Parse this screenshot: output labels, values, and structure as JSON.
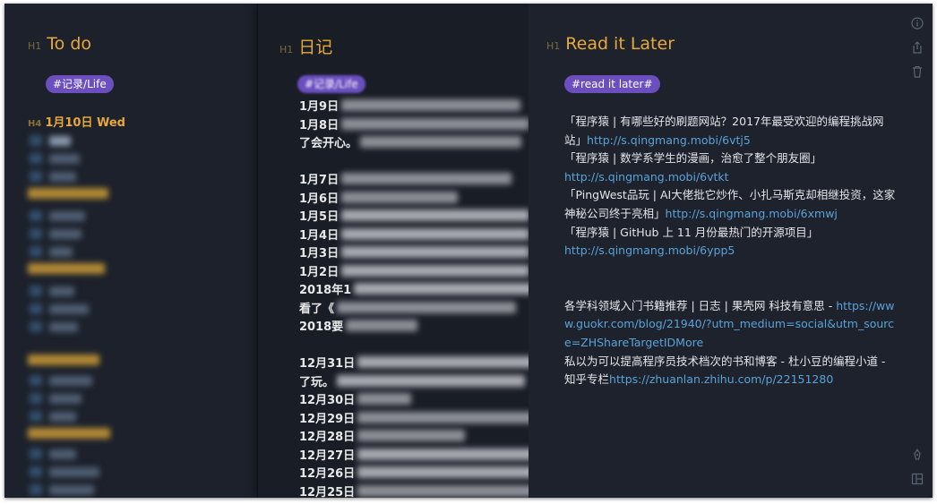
{
  "panes": {
    "left": {
      "heading_mark": "H1",
      "heading": "To do",
      "tag": "#记录/Life",
      "date_mark": "H4",
      "date": "1月10日 Wed"
    },
    "middle": {
      "heading_mark": "H1",
      "heading": "日记",
      "tag": "#记录/Life",
      "lines": [
        "1月9日",
        "1月8日",
        "了会开心。",
        "",
        "1月7日",
        "1月6日",
        "1月5日",
        "1月4日",
        "1月3日",
        "1月2日",
        "2018年1",
        "看了《",
        "2018要",
        "",
        "12月31日",
        "了玩。",
        "12月30日",
        "12月29日",
        "12月28日",
        "12月27日",
        "12月26日",
        "12月25日"
      ]
    },
    "right": {
      "heading_mark": "H1",
      "heading": "Read it Later",
      "tag": "#read it later#",
      "entry1_text": "「程序猿 | 有哪些好的刷题网站？2017年最受欢迎的编程挑战网站」",
      "entry1_link": "http://s.qingmang.mobi/6vtj5",
      "entry2_text": "「程序猿 | 数学系学生的漫画，治愈了整个朋友圈」",
      "entry2_link": "http://s.qingmang.mobi/6vtkt",
      "entry3_text": "「PingWest品玩 | AI大佬批它炒作、小扎马斯克却相继投资，这家神秘公司终于亮相」",
      "entry3_link": "http://s.qingmang.mobi/6xmwj",
      "entry4_text": "「程序猿 | GitHub 上 11 月份最热门的开源项目」",
      "entry4_link": "http://s.qingmang.mobi/6ypp5",
      "entry5_text": "各学科领域入门书籍推荐 | 日志 | 果壳网 科技有意思 - ",
      "entry5_link": "https://www.guokr.com/blog/21940/?utm_medium=social&utm_source=ZHShareTargetIDMore",
      "entry6_text": "私以为可以提高程序员技术档次的书和博客 - 杜小豆的编程小道 - 知乎专栏",
      "entry6_link": "https://zhuanlan.zhihu.com/p/22151280"
    }
  },
  "toolbar": {
    "icons": [
      "info-icon",
      "share-icon",
      "trash-icon",
      "pen-icon",
      "layout-icon"
    ]
  },
  "colors": {
    "heading": "#e8a83a",
    "tag": "#6b4fbf",
    "link": "#5aa3d8",
    "background": "#1d222c"
  }
}
